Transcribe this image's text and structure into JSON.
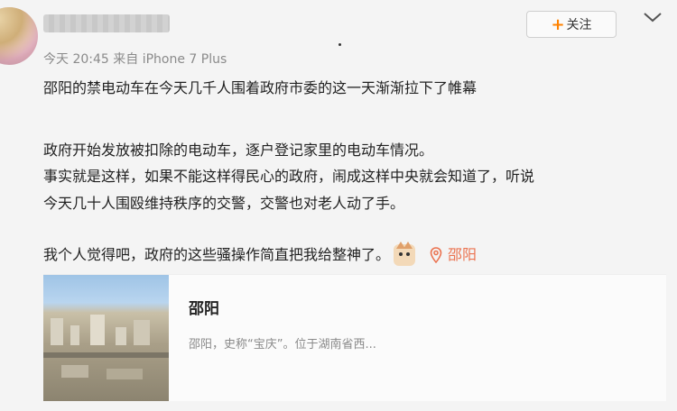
{
  "header": {
    "meta": "今天 20:45 来自 iPhone 7 Plus",
    "follow_label": "关注",
    "follow_icon": "plus-icon",
    "more_icon": "chevron-down-icon"
  },
  "post": {
    "lines": [
      "邵阳的禁电动车在今天几千人围着政府市委的这一天渐渐拉下了帷幕",
      "政府开始发放被扣除的电动车，逐户登记家里的电动车情况。",
      "事实就是这样，如果不能这样得民心的政府，闹成这样中央就会知道了，听说",
      "今天几十人围殴维持秩序的交警，交警也对老人动了手。",
      "我个人觉得吧，政府的这些骚操作简直把我给整神了。"
    ],
    "emoji_icon": "cat-emoji-icon",
    "location_label": "邵阳",
    "location_icon": "location-pin-icon",
    "accent_color": "#eb7350"
  },
  "card": {
    "title": "邵阳",
    "description": "邵阳，史称“宝庆”。位于湖南省西..."
  }
}
